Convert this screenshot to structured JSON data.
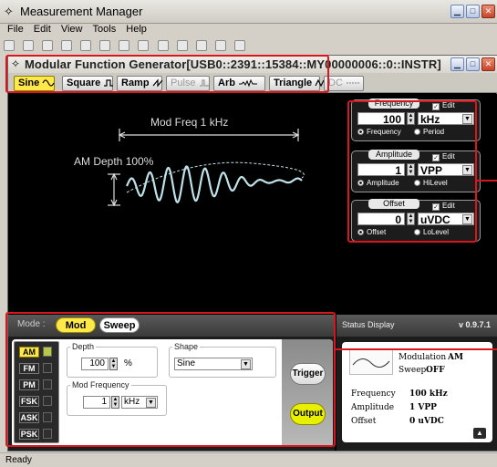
{
  "window": {
    "title": "Measurement Manager"
  },
  "menu": [
    "File",
    "Edit",
    "View",
    "Tools",
    "Help"
  ],
  "instrument": {
    "title": "Modular Function Generator[USB0::2391::15384::MY00000006::0::INSTR]"
  },
  "waveforms": [
    {
      "label": "Sine",
      "active": true,
      "enabled": true
    },
    {
      "label": "Square",
      "active": false,
      "enabled": true
    },
    {
      "label": "Ramp",
      "active": false,
      "enabled": true
    },
    {
      "label": "Pulse",
      "active": false,
      "enabled": false
    },
    {
      "label": "Arb",
      "active": false,
      "enabled": true
    },
    {
      "label": "Triangle",
      "active": false,
      "enabled": true
    },
    {
      "label": "DC",
      "active": false,
      "enabled": false
    }
  ],
  "display": {
    "mod_freq_label": "Mod Freq 1 kHz",
    "am_depth_label": "AM Depth 100%"
  },
  "frequency": {
    "title": "Frequency",
    "edit_label": "Edit",
    "value": "100",
    "unit": "kHz",
    "options": [
      "Frequency",
      "Period"
    ],
    "selected": "Frequency"
  },
  "amplitude": {
    "title": "Amplitude",
    "edit_label": "Edit",
    "value": "1",
    "unit": "VPP",
    "options": [
      "Amplitude",
      "HiLevel"
    ],
    "selected": "Amplitude"
  },
  "offset": {
    "title": "Offset",
    "edit_label": "Edit",
    "value": "0",
    "unit": "uVDC",
    "options": [
      "Offset",
      "LoLevel"
    ],
    "selected": "Offset"
  },
  "mode": {
    "label": "Mode :",
    "tabs": [
      "Mod",
      "Sweep"
    ],
    "active": "Mod"
  },
  "modulation": {
    "types": [
      "AM",
      "FM",
      "PM",
      "FSK",
      "ASK",
      "PSK"
    ],
    "active": "AM",
    "depth_label": "Depth",
    "depth_value": "100",
    "depth_unit": "%",
    "shape_label": "Shape",
    "shape_value": "Sine",
    "mod_freq_label": "Mod Frequency",
    "mod_freq_value": "1",
    "mod_freq_unit": "kHz"
  },
  "buttons": {
    "trigger": "Trigger",
    "output": "Output"
  },
  "status": {
    "title": "Status Display",
    "version": "v 0.9.7.1",
    "modulation_label": "Modulation",
    "modulation_value": "AM",
    "sweep_label": "Sweep",
    "sweep_value": "OFF",
    "rows": [
      {
        "label": "Frequency",
        "value": "100 kHz"
      },
      {
        "label": "Amplitude",
        "value": "1 VPP"
      },
      {
        "label": "Offset",
        "value": "0 uVDC"
      }
    ]
  },
  "statusbar": {
    "text": "Ready"
  },
  "colors": {
    "accent_yellow": "#ffe84a",
    "highlight_red": "#d8161e",
    "output_button": "#e8f000",
    "waveform_cyan": "#bfe3ea"
  }
}
